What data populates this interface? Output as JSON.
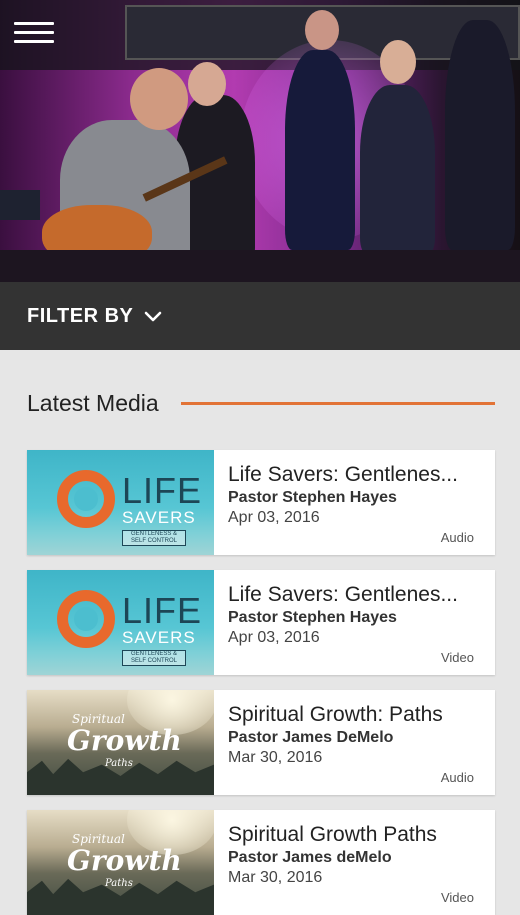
{
  "header": {
    "menu_icon": "hamburger-menu-icon"
  },
  "filter": {
    "label": "FILTER BY",
    "icon": "chevron-down-icon"
  },
  "section": {
    "title": "Latest Media",
    "accent_color": "#e27336"
  },
  "media": [
    {
      "title": "Life Savers: Gentlenes...",
      "author": "Pastor Stephen Hayes",
      "date": "Apr 03, 2016",
      "type": "Audio",
      "thumb": {
        "style": "life",
        "line1": "LIFE",
        "line2": "SAVERS",
        "line3": "GENTLENESS & SELF CONTROL"
      }
    },
    {
      "title": "Life Savers: Gentlenes...",
      "author": "Pastor Stephen Hayes",
      "date": "Apr 03, 2016",
      "type": "Video",
      "thumb": {
        "style": "life",
        "line1": "LIFE",
        "line2": "SAVERS",
        "line3": "GENTLENESS & SELF CONTROL"
      }
    },
    {
      "title": "Spiritual Growth: Paths",
      "author": "Pastor James DeMelo",
      "date": "Mar 30, 2016",
      "type": "Audio",
      "thumb": {
        "style": "growth",
        "line1": "Spiritual",
        "line2": "Growth",
        "line3": "Paths"
      }
    },
    {
      "title": "Spiritual Growth Paths",
      "author": "Pastor James deMelo",
      "date": "Mar 30, 2016",
      "type": "Video",
      "thumb": {
        "style": "growth",
        "line1": "Spiritual",
        "line2": "Growth",
        "line3": "Paths"
      }
    }
  ]
}
